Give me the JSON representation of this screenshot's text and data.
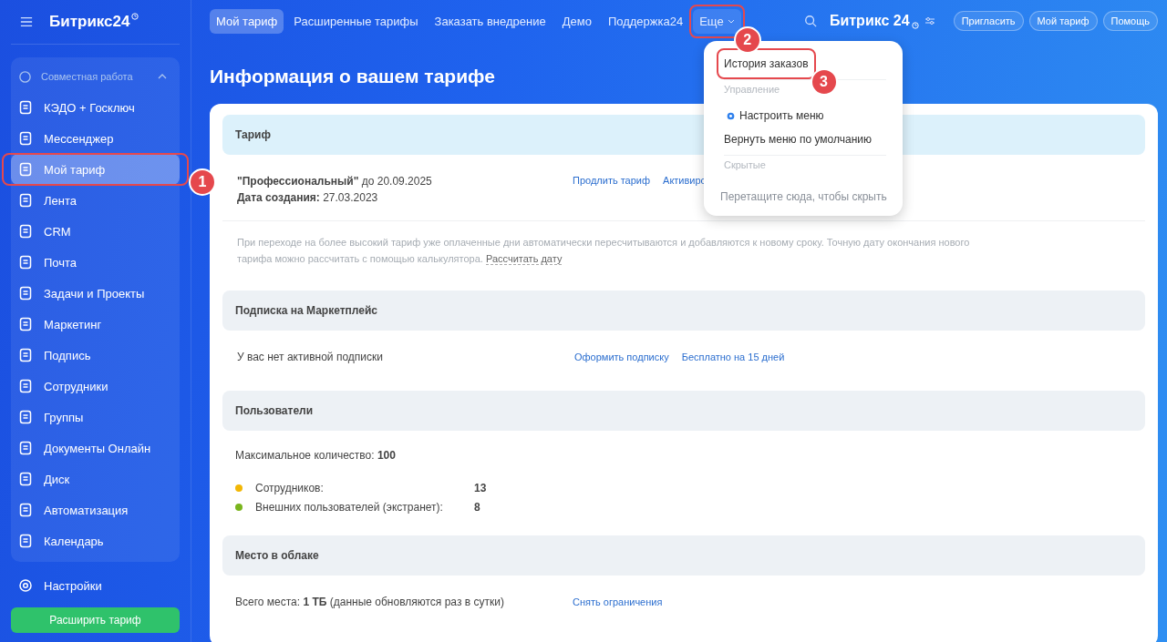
{
  "sidebar": {
    "logo": "Битрикс24",
    "group": {
      "label": "Совместная работа",
      "expanded": true,
      "items": [
        {
          "label": "КЭДО + Госключ",
          "selected": false
        },
        {
          "label": "Мессенджер",
          "selected": false
        },
        {
          "label": "Мой тариф",
          "selected": true,
          "annotation": "1"
        },
        {
          "label": "Лента",
          "selected": false
        },
        {
          "label": "CRM",
          "selected": false
        },
        {
          "label": "Почта",
          "selected": false
        },
        {
          "label": "Задачи и Проекты",
          "selected": false
        },
        {
          "label": "Маркетинг",
          "selected": false
        },
        {
          "label": "Подпись",
          "selected": false
        },
        {
          "label": "Сотрудники",
          "selected": false
        },
        {
          "label": "Группы",
          "selected": false
        },
        {
          "label": "Документы Онлайн",
          "selected": false
        },
        {
          "label": "Диск",
          "selected": false
        },
        {
          "label": "Автоматизация",
          "selected": false
        },
        {
          "label": "Календарь",
          "selected": false
        }
      ]
    },
    "settings": "Настройки",
    "upgrade_button": "Расширить тариф"
  },
  "top_nav": {
    "items": [
      {
        "label": "Мой тариф",
        "selected": true
      },
      {
        "label": "Расширенные тарифы",
        "selected": false
      },
      {
        "label": "Заказать внедрение",
        "selected": false
      },
      {
        "label": "Демо",
        "selected": false
      },
      {
        "label": "Поддержка24",
        "selected": false
      },
      {
        "label": "Еще",
        "selected": false,
        "annotation": "2"
      }
    ],
    "logo": "Битрикс 24",
    "buttons": [
      "Пригласить",
      "Мой тариф",
      "Помощь"
    ]
  },
  "more_menu": {
    "items": [
      {
        "kind": "item",
        "label": "История заказов",
        "annotation": "3"
      },
      {
        "kind": "section",
        "label": "Управление"
      },
      {
        "kind": "setting",
        "label": "Настроить меню"
      },
      {
        "kind": "item",
        "label": "Вернуть меню по умолчанию"
      },
      {
        "kind": "section",
        "label": "Скрытые"
      },
      {
        "kind": "hint",
        "label": "Перетащите сюда, чтобы скрыть"
      }
    ]
  },
  "page_title": "Информация о вашем тарифе",
  "tariff": {
    "header": "Тариф",
    "name": "\"Профессиональный\"",
    "until": "до 20.09.2025",
    "created_label": "Дата создания:",
    "created": "27.03.2023",
    "links": [
      "Продлить тариф",
      "Активиро"
    ],
    "note": "При переходе на более высокий тариф уже оплаченные дни автоматически пересчитываются и добавляются к новому сроку. Точную дату окончания нового тарифа можно рассчитать с помощью калькулятора.",
    "note_link": "Рассчитать дату"
  },
  "marketplace": {
    "header": "Подписка на Маркетплейс",
    "status": "У вас нет активной подписки",
    "links": [
      "Оформить подписку",
      "Бесплатно на 15 дней"
    ]
  },
  "users": {
    "header": "Пользователи",
    "max": "Максимальное количество: **100**",
    "rows": [
      {
        "label": "Сотрудников:",
        "value": "13",
        "color": "#f2b705"
      },
      {
        "label": "Внешних пользователей (экстранет):",
        "value": "8",
        "color": "#7ab51d"
      }
    ]
  },
  "cloud": {
    "header": "Место в облаке",
    "total": "Всего места: **1 ТБ** (данные обновляются раз в сутки)",
    "link": "Снять ограничения"
  }
}
